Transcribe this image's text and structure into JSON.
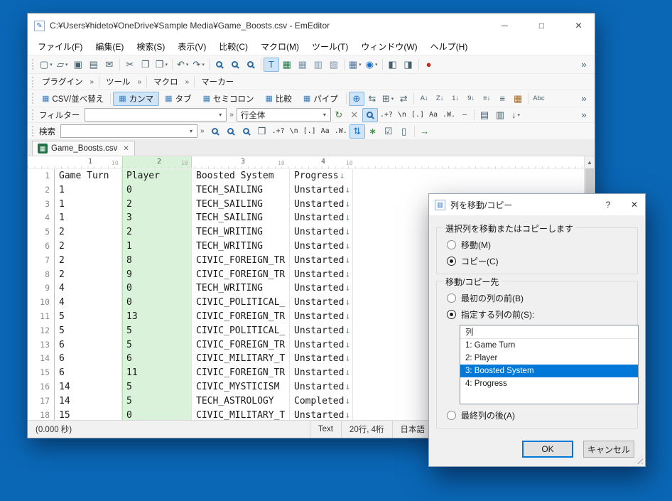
{
  "glyphs": {
    "dropdown": "▾",
    "chevron": "»",
    "grid": "▦",
    "panel": "▥",
    "pencil": "✎",
    "up_arrow": "▲",
    "down_arrow": "▼"
  },
  "window": {
    "title": "C:¥Users¥hideto¥OneDrive¥Sample Media¥Game_Boosts.csv - EmEditor",
    "controls": {
      "minimize": "─",
      "maximize": "□",
      "close": "✕"
    }
  },
  "menu": {
    "items": [
      "ファイル(F)",
      "編集(E)",
      "検索(S)",
      "表示(V)",
      "比較(C)",
      "マクロ(M)",
      "ツール(T)",
      "ウィンドウ(W)",
      "ヘルプ(H)"
    ]
  },
  "toolbars": {
    "main": {
      "icons": [
        {
          "name": "new-file-button",
          "glyph": "▢",
          "dropdown": true
        },
        {
          "name": "open-file-button",
          "glyph": "▱",
          "dropdown": true
        },
        {
          "name": "save-button",
          "glyph": "▣"
        },
        {
          "name": "print-button",
          "glyph": "▤"
        },
        {
          "name": "send-mail-button",
          "glyph": "✉"
        },
        {
          "separator": true
        },
        {
          "name": "cut-button",
          "glyph": "✂"
        },
        {
          "name": "copy-button",
          "glyph": "❐"
        },
        {
          "name": "paste-button",
          "glyph": "❒",
          "dropdown": true
        },
        {
          "separator": true
        },
        {
          "name": "undo-button",
          "glyph": "↶",
          "dropdown": true
        },
        {
          "name": "redo-button",
          "glyph": "↷",
          "dropdown": true
        },
        {
          "separator": true
        },
        {
          "name": "find-button",
          "type": "mag"
        },
        {
          "name": "find-in-files-button",
          "type": "mag"
        },
        {
          "name": "replace-button",
          "type": "mag"
        },
        {
          "separator": true
        },
        {
          "name": "text-mode-button",
          "glyph": "T",
          "color": "#1d70c4",
          "active": true
        },
        {
          "name": "csv-mode-button",
          "glyph": "▦",
          "color": "#217346"
        },
        {
          "name": "table-view-button",
          "glyph": "▦",
          "color": "#7d93a8"
        },
        {
          "name": "split-view-button",
          "glyph": "▥",
          "color": "#7d93a8"
        },
        {
          "name": "workspace-button",
          "glyph": "▧",
          "color": "#7d93a8"
        },
        {
          "separator": true
        },
        {
          "name": "table-edit-button",
          "glyph": "▦",
          "color": "#51749b",
          "dropdown": true
        },
        {
          "name": "web-preview-button",
          "glyph": "◉",
          "color": "#1d70c4",
          "dropdown": true
        },
        {
          "separator": true
        },
        {
          "name": "compare-button",
          "glyph": "◧"
        },
        {
          "name": "sync-scroll-button",
          "glyph": "◨"
        },
        {
          "separator": true
        },
        {
          "name": "record-macro-button",
          "glyph": "●",
          "color": "#c42b1c"
        },
        {
          "name": "main-toolbar-overflow-button",
          "glyph": "»",
          "push_right": true
        }
      ]
    },
    "plugins": {
      "groups": [
        "プラグイン",
        "ツール",
        "マクロ",
        "マーカー"
      ]
    },
    "csv": {
      "label": "CSV/並べ替え",
      "modes": [
        "カンマ",
        "タブ",
        "セミコロン",
        "比較",
        "パイプ"
      ],
      "selected_mode": "カンマ",
      "icons": [
        {
          "name": "cell-selection-button",
          "glyph": "⊕",
          "color": "#1d70c4",
          "active": true
        },
        {
          "name": "convert-csv-button",
          "glyph": "⇆"
        },
        {
          "name": "manage-columns-button",
          "glyph": "⊞",
          "dropdown": true
        },
        {
          "name": "move-copy-column-button",
          "glyph": "⇄"
        },
        {
          "separator": true
        },
        {
          "name": "sort-az-button",
          "glyph": "A↓",
          "small": true
        },
        {
          "name": "sort-za-button",
          "glyph": "Z↓",
          "small": true
        },
        {
          "name": "sort-ascending-button",
          "glyph": "1↓",
          "small": true
        },
        {
          "name": "sort-descending-button",
          "glyph": "9↓",
          "small": true
        },
        {
          "name": "sort-options-button",
          "glyph": "≡↓",
          "small": true
        },
        {
          "name": "multi-sort-button",
          "glyph": "≡"
        },
        {
          "name": "date-column-button",
          "glyph": "▦",
          "color": "#a06a28"
        },
        {
          "separator": true
        },
        {
          "name": "spell-check-button",
          "glyph": "Abc",
          "small": true
        },
        {
          "name": "csv-toolbar-overflow-button",
          "glyph": "»",
          "push_right": true
        }
      ]
    },
    "filter": {
      "label": "フィルター",
      "value": "",
      "scope_value": "行全体",
      "icons": [
        {
          "name": "refresh-filter-button",
          "glyph": "↻",
          "color": "#3f7d3f"
        },
        {
          "name": "clear-filter-button",
          "glyph": "✕",
          "color": "#8a8a8a"
        },
        {
          "name": "apply-filter-button",
          "type": "mag",
          "active": true
        },
        {
          "name": "regex-filter-button",
          "glyph": ".+?",
          "op": true
        },
        {
          "name": "escape-filter-button",
          "glyph": "\\n",
          "op": true
        },
        {
          "name": "bracket-filter-button",
          "glyph": "[.]",
          "op": true
        },
        {
          "name": "match-case-filter-button",
          "glyph": "Aa",
          "op": true
        },
        {
          "name": "whole-word-filter-button",
          "glyph": ".W.",
          "op": true
        },
        {
          "name": "negative-filter-button",
          "glyph": "—",
          "op": true
        },
        {
          "separator": true
        },
        {
          "name": "filter-history-button",
          "glyph": "▤"
        },
        {
          "name": "filter-list-button",
          "glyph": "▥"
        },
        {
          "name": "filter-down-button",
          "glyph": "↓",
          "dropdown": true
        },
        {
          "name": "filter-toolbar-overflow-button",
          "glyph": "»",
          "push_right": true
        }
      ]
    },
    "search": {
      "label": "検索",
      "value": "",
      "icons": [
        {
          "name": "find-next-button",
          "type": "mag"
        },
        {
          "name": "find-previous-button",
          "type": "mag"
        },
        {
          "name": "find-all-button",
          "type": "mag"
        },
        {
          "name": "find-extract-button",
          "glyph": "❐"
        },
        {
          "name": "regex-search-button",
          "glyph": ".+?",
          "op": true
        },
        {
          "name": "escape-search-button",
          "glyph": "\\n",
          "op": true
        },
        {
          "name": "bracket-search-button",
          "glyph": "[.]",
          "op": true
        },
        {
          "name": "match-case-search-button",
          "glyph": "Aa",
          "op": true
        },
        {
          "name": "whole-word-search-button",
          "glyph": ".W.",
          "op": true
        },
        {
          "name": "swap-search-button",
          "glyph": "⇅",
          "color": "#1d70c4",
          "active": true
        },
        {
          "name": "wildcard-search-button",
          "glyph": "∗",
          "color": "#2e8b2e"
        },
        {
          "name": "search-list-button",
          "glyph": "☑"
        },
        {
          "name": "search-page-button",
          "glyph": "▯"
        },
        {
          "separator": true
        },
        {
          "name": "jump-button",
          "glyph": "→",
          "color": "#2e8b2e"
        }
      ]
    }
  },
  "tab": {
    "label": "Game_Boosts.csv",
    "close": "✕"
  },
  "ruler": {
    "markers": [
      "1",
      "2",
      "3",
      "4"
    ],
    "tick": "10"
  },
  "csv": {
    "columns": [
      "Game Turn",
      "Player",
      "Boosted System",
      "Progress"
    ],
    "selected_column_index": 1,
    "newline_glyph": "↓",
    "rows": [
      {
        "line": "1",
        "cells": [
          "Game Turn",
          "Player",
          "Boosted System",
          "Progress"
        ]
      },
      {
        "line": "2",
        "cells": [
          "1",
          "0",
          "TECH_SAILING",
          "Unstarted"
        ]
      },
      {
        "line": "3",
        "cells": [
          "1",
          "2",
          "TECH_SAILING",
          "Unstarted"
        ]
      },
      {
        "line": "4",
        "cells": [
          "1",
          "3",
          "TECH_SAILING",
          "Unstarted"
        ]
      },
      {
        "line": "5",
        "cells": [
          "2",
          "2",
          "TECH_WRITING",
          "Unstarted"
        ]
      },
      {
        "line": "6",
        "cells": [
          "2",
          "1",
          "TECH_WRITING",
          "Unstarted"
        ]
      },
      {
        "line": "7",
        "cells": [
          "2",
          "8",
          "CIVIC_FOREIGN_TR",
          "Unstarted"
        ]
      },
      {
        "line": "8",
        "cells": [
          "2",
          "9",
          "CIVIC_FOREIGN_TR",
          "Unstarted"
        ]
      },
      {
        "line": "9",
        "cells": [
          "4",
          "0",
          "TECH_WRITING",
          "Unstarted"
        ]
      },
      {
        "line": "10",
        "cells": [
          "4",
          "0",
          "CIVIC_POLITICAL_",
          "Unstarted"
        ]
      },
      {
        "line": "11",
        "cells": [
          "5",
          "13",
          "CIVIC_FOREIGN_TR",
          "Unstarted"
        ]
      },
      {
        "line": "12",
        "cells": [
          "5",
          "5",
          "CIVIC_POLITICAL_",
          "Unstarted"
        ]
      },
      {
        "line": "13",
        "cells": [
          "6",
          "5",
          "CIVIC_FOREIGN_TR",
          "Unstarted"
        ]
      },
      {
        "line": "14",
        "cells": [
          "6",
          "6",
          "CIVIC_MILITARY_T",
          "Unstarted"
        ]
      },
      {
        "line": "15",
        "cells": [
          "6",
          "11",
          "CIVIC_FOREIGN_TR",
          "Unstarted"
        ]
      },
      {
        "line": "16",
        "cells": [
          "14",
          "5",
          "CIVIC_MYSTICISM",
          "Unstarted"
        ]
      },
      {
        "line": "17",
        "cells": [
          "14",
          "5",
          "TECH_ASTROLOGY",
          "Completed"
        ]
      },
      {
        "line": "18",
        "cells": [
          "15",
          "0",
          "CIVIC_MILITARY_T",
          "Unstarted"
        ]
      }
    ]
  },
  "status": {
    "left": "(0.000 秒)",
    "items": [
      "Text",
      "20行, 4桁",
      "日本語"
    ]
  },
  "dialog": {
    "title": "列を移動/コピー",
    "help": "?",
    "close": "✕",
    "group1": {
      "label": "選択列を移動またはコピーします",
      "radios": [
        {
          "label": "移動(M)",
          "checked": false
        },
        {
          "label": "コピー(C)",
          "checked": true
        }
      ]
    },
    "group2": {
      "label": "移動/コピー先",
      "radio_first": {
        "label": "最初の列の前(B)",
        "checked": false
      },
      "radio_specified": {
        "label": "指定する列の前(S):",
        "checked": true
      },
      "list": {
        "header": "列",
        "items": [
          "1: Game Turn",
          "2: Player",
          "3: Boosted System",
          "4: Progress"
        ],
        "selected_index": 2
      },
      "radio_last": {
        "label": "最終列の後(A)",
        "checked": false
      }
    },
    "buttons": {
      "ok": "OK",
      "cancel": "キャンセル"
    }
  }
}
